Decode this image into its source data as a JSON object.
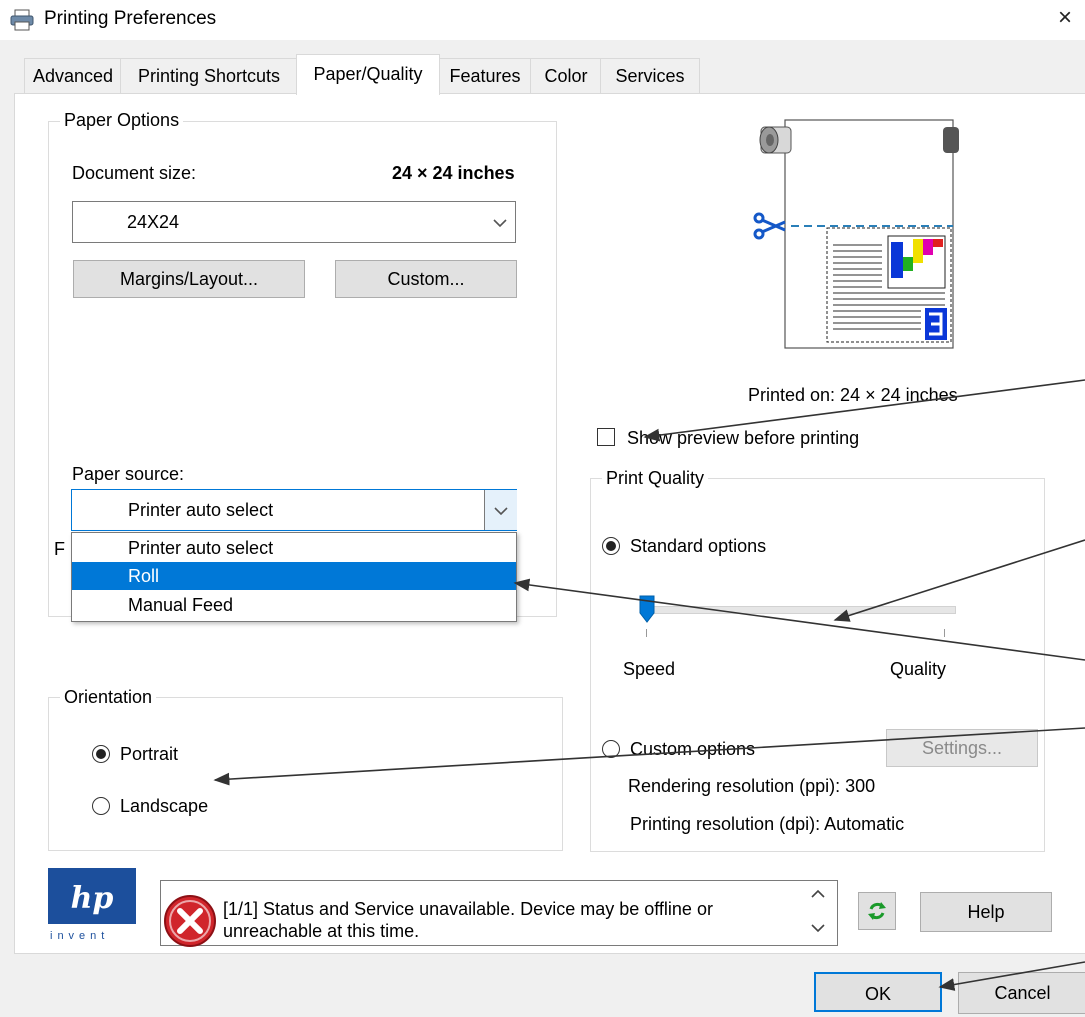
{
  "window": {
    "title": "Printing Preferences",
    "close_glyph": "×"
  },
  "tabs": [
    {
      "label": "Advanced"
    },
    {
      "label": "Printing Shortcuts"
    },
    {
      "label": "Paper/Quality",
      "active": true
    },
    {
      "label": "Features"
    },
    {
      "label": "Color"
    },
    {
      "label": "Services"
    }
  ],
  "paper_options": {
    "group_label": "Paper Options",
    "document_size_label": "Document size:",
    "document_size_value": "24 × 24 inches",
    "size_selected": "24X24",
    "margins_button": "Margins/Layout...",
    "custom_button": "Custom...",
    "paper_source_label": "Paper source:",
    "paper_source_selected": "Printer auto select",
    "paper_source_options": [
      "Printer auto select",
      "Roll",
      "Manual Feed"
    ],
    "paper_source_highlighted": "Roll",
    "hidden_label_fragment": "F"
  },
  "orientation": {
    "group_label": "Orientation",
    "portrait_label": "Portrait",
    "landscape_label": "Landscape",
    "selected": "Portrait"
  },
  "preview": {
    "printed_on": "Printed on: 24 × 24 inches",
    "show_preview_label": "Show preview before printing",
    "show_preview_checked": false
  },
  "print_quality": {
    "group_label": "Print Quality",
    "standard_label": "Standard options",
    "speed_label": "Speed",
    "quality_label": "Quality",
    "slider_level": 0,
    "custom_label": "Custom options",
    "settings_button": "Settings...",
    "rendering_resolution": "Rendering resolution (ppi): 300",
    "printing_resolution": "Printing resolution (dpi): Automatic",
    "selected": "Standard options"
  },
  "status": {
    "message_line1": "[1/1] Status and Service unavailable. Device may be offline or",
    "message_line2": "unreachable at this time.",
    "help_button": "Help",
    "logo_text": "invent"
  },
  "footer": {
    "ok_button": "OK",
    "cancel_button": "Cancel"
  },
  "colors": {
    "selection": "#0078d7",
    "accent_border": "#0078d7",
    "hp_blue": "#1c4f9c",
    "error_red": "#d0252b"
  }
}
